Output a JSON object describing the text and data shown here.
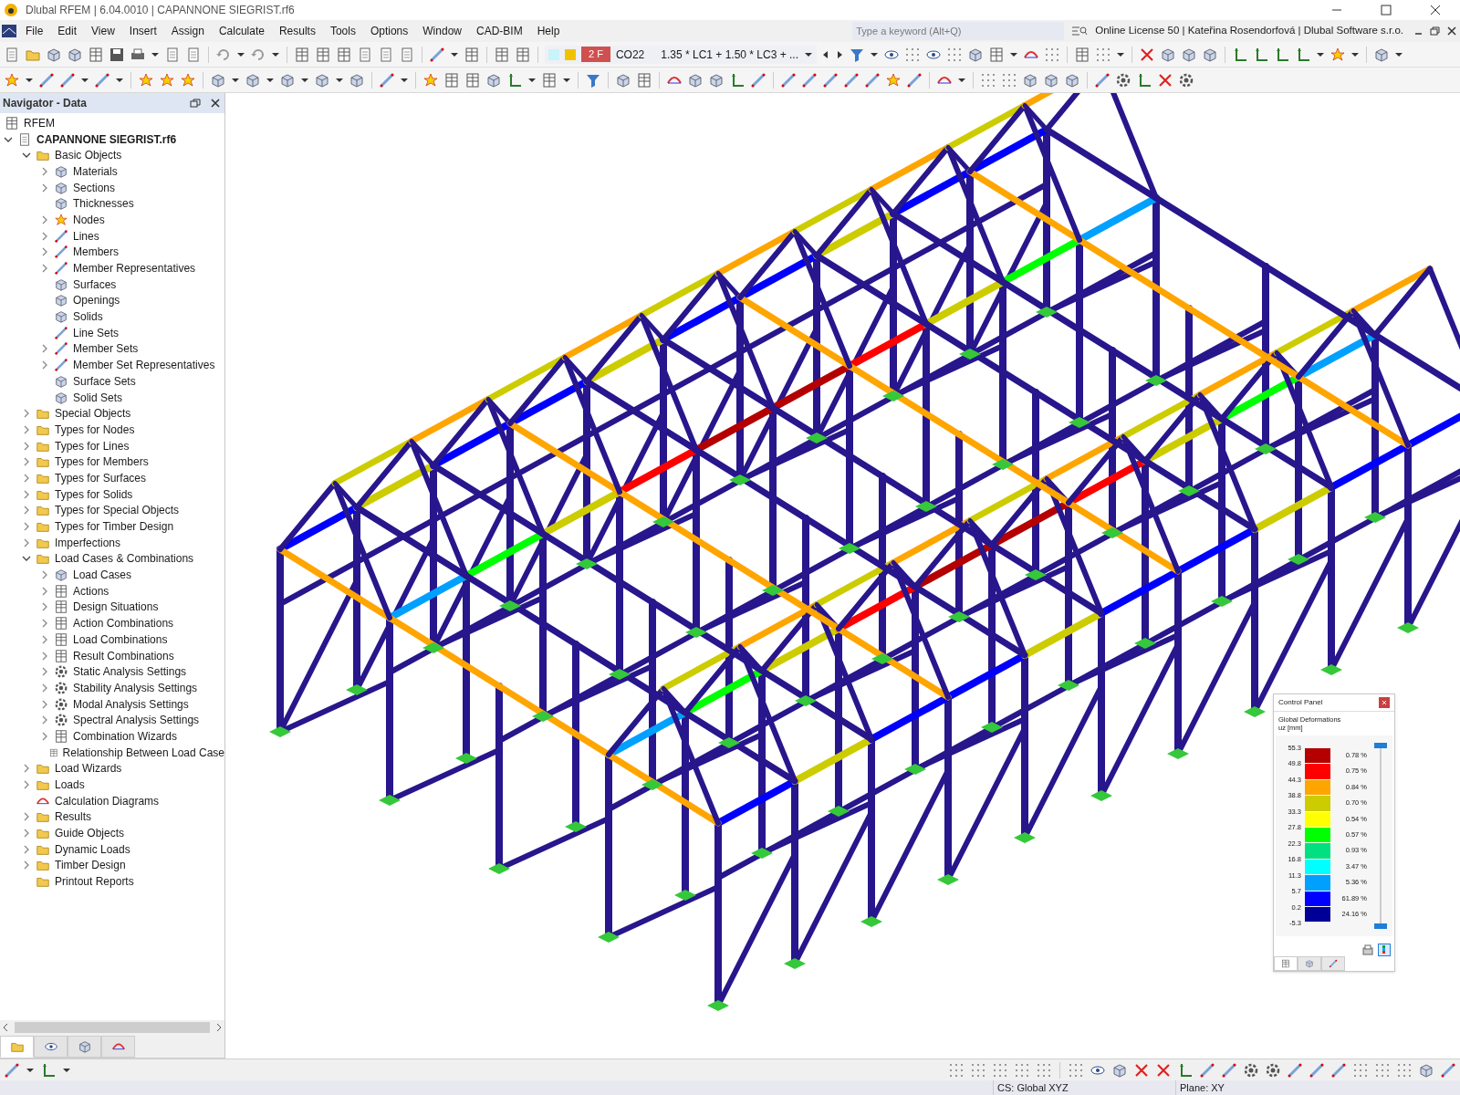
{
  "window": {
    "title": "Dlubal RFEM | 6.04.0010 | CAPANNONE SIEGRIST.rf6"
  },
  "menu": [
    "File",
    "Edit",
    "View",
    "Insert",
    "Assign",
    "Calculate",
    "Results",
    "Tools",
    "Options",
    "Window",
    "CAD-BIM",
    "Help"
  ],
  "search": {
    "placeholder": "Type a keyword (Alt+Q)"
  },
  "license": "Online License 50 | Kateřina Rosendorfová | Dlubal Software s.r.o.",
  "load_selector": {
    "badge": "2 F",
    "name": "CO22",
    "combination": "1.35 * LC1 + 1.50 * LC3 + ..."
  },
  "navigator": {
    "title": "Navigator - Data",
    "tree": [
      {
        "label": "RFEM",
        "kind": "app"
      },
      {
        "label": "CAPANNONE SIEGRIST.rf6",
        "kind": "file",
        "expanded": true,
        "children": [
          {
            "label": "Basic Objects",
            "kind": "folder",
            "expanded": true,
            "children": [
              {
                "label": "Materials",
                "kind": "item",
                "expanded": false
              },
              {
                "label": "Sections",
                "kind": "item",
                "expanded": false
              },
              {
                "label": "Thicknesses",
                "kind": "item"
              },
              {
                "label": "Nodes",
                "kind": "node",
                "expanded": false
              },
              {
                "label": "Lines",
                "kind": "line",
                "expanded": false
              },
              {
                "label": "Members",
                "kind": "line",
                "expanded": false
              },
              {
                "label": "Member Representatives",
                "kind": "line",
                "expanded": false
              },
              {
                "label": "Surfaces",
                "kind": "item"
              },
              {
                "label": "Openings",
                "kind": "item"
              },
              {
                "label": "Solids",
                "kind": "item"
              },
              {
                "label": "Line Sets",
                "kind": "line"
              },
              {
                "label": "Member Sets",
                "kind": "line",
                "expanded": false
              },
              {
                "label": "Member Set Representatives",
                "kind": "line",
                "expanded": false
              },
              {
                "label": "Surface Sets",
                "kind": "item"
              },
              {
                "label": "Solid Sets",
                "kind": "item"
              }
            ]
          },
          {
            "label": "Special Objects",
            "kind": "folder",
            "expanded": false
          },
          {
            "label": "Types for Nodes",
            "kind": "folder",
            "expanded": false
          },
          {
            "label": "Types for Lines",
            "kind": "folder",
            "expanded": false
          },
          {
            "label": "Types for Members",
            "kind": "folder",
            "expanded": false
          },
          {
            "label": "Types for Surfaces",
            "kind": "folder",
            "expanded": false
          },
          {
            "label": "Types for Solids",
            "kind": "folder",
            "expanded": false
          },
          {
            "label": "Types for Special Objects",
            "kind": "folder",
            "expanded": false
          },
          {
            "label": "Types for Timber Design",
            "kind": "folder",
            "expanded": false
          },
          {
            "label": "Imperfections",
            "kind": "folder",
            "expanded": false
          },
          {
            "label": "Load Cases & Combinations",
            "kind": "folder",
            "expanded": true,
            "children": [
              {
                "label": "Load Cases",
                "kind": "item",
                "expanded": false
              },
              {
                "label": "Actions",
                "kind": "combo",
                "expanded": false
              },
              {
                "label": "Design Situations",
                "kind": "combo",
                "expanded": false
              },
              {
                "label": "Action Combinations",
                "kind": "combo",
                "expanded": false
              },
              {
                "label": "Load Combinations",
                "kind": "combo",
                "expanded": false
              },
              {
                "label": "Result Combinations",
                "kind": "combo",
                "expanded": false
              },
              {
                "label": "Static Analysis Settings",
                "kind": "gear",
                "expanded": false
              },
              {
                "label": "Stability Analysis Settings",
                "kind": "gear",
                "expanded": false
              },
              {
                "label": "Modal Analysis Settings",
                "kind": "gear",
                "expanded": false
              },
              {
                "label": "Spectral Analysis Settings",
                "kind": "gear",
                "expanded": false
              },
              {
                "label": "Combination Wizards",
                "kind": "combo",
                "expanded": false
              },
              {
                "label": "Relationship Between Load Case",
                "kind": "combo"
              }
            ]
          },
          {
            "label": "Load Wizards",
            "kind": "folder",
            "expanded": false
          },
          {
            "label": "Loads",
            "kind": "folder",
            "expanded": false
          },
          {
            "label": "Calculation Diagrams",
            "kind": "diagram"
          },
          {
            "label": "Results",
            "kind": "folder",
            "expanded": false
          },
          {
            "label": "Guide Objects",
            "kind": "folder",
            "expanded": false
          },
          {
            "label": "Dynamic Loads",
            "kind": "folder",
            "expanded": false
          },
          {
            "label": "Timber Design",
            "kind": "folder",
            "expanded": false
          },
          {
            "label": "Printout Reports",
            "kind": "folder"
          }
        ]
      }
    ],
    "tabs": [
      {
        "selected": true
      },
      {
        "selected": false
      },
      {
        "selected": false
      },
      {
        "selected": false
      }
    ]
  },
  "control_panel": {
    "title": "Control Panel",
    "result": "Global Deformations",
    "quantity": "uz [mm]",
    "ticks": [
      "55.3",
      "49.8",
      "44.3",
      "38.8",
      "33.3",
      "27.8",
      "22.3",
      "16.8",
      "11.3",
      "5.7",
      "0.2",
      "-5.3"
    ],
    "bands": [
      {
        "color": "#b40000",
        "share": "0.78 %"
      },
      {
        "color": "#ff0000",
        "share": "0.75 %"
      },
      {
        "color": "#ffa500",
        "share": "0.84 %"
      },
      {
        "color": "#cccc00",
        "share": "0.70 %"
      },
      {
        "color": "#ffff00",
        "share": "0.54 %"
      },
      {
        "color": "#00ff00",
        "share": "0.57 %"
      },
      {
        "color": "#00e080",
        "share": "0.93 %"
      },
      {
        "color": "#00ffff",
        "share": "3.47 %"
      },
      {
        "color": "#00a0ff",
        "share": "5.36 %"
      },
      {
        "color": "#0000ff",
        "share": "61.89 %"
      },
      {
        "color": "#000096",
        "share": "24.16 %"
      }
    ],
    "range_slider": {
      "level": 1
    },
    "tabs": [
      {
        "selected": true
      },
      {
        "selected": false
      },
      {
        "selected": false
      }
    ]
  },
  "status_bar": [
    "CS: Global XYZ",
    "Plane: XY"
  ]
}
